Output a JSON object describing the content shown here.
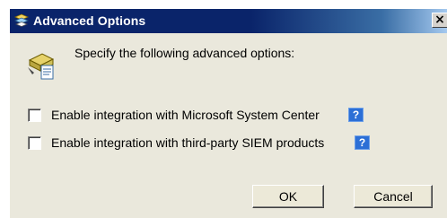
{
  "window": {
    "title": "Advanced Options",
    "close_glyph": "×",
    "title_icon": "options-icon"
  },
  "header": {
    "icon": "advanced-options-icon",
    "text": "Specify the following advanced options:"
  },
  "options": [
    {
      "label": "Enable integration with Microsoft System Center",
      "checked": false,
      "help": "?"
    },
    {
      "label": "Enable integration with third-party SIEM products",
      "checked": false,
      "help": "?"
    }
  ],
  "buttons": {
    "ok": "OK",
    "cancel": "Cancel"
  },
  "colors": {
    "titlebar": "#0a246a",
    "dialog_bg": "#eae8dc",
    "help_button": "#2c6fd6"
  }
}
